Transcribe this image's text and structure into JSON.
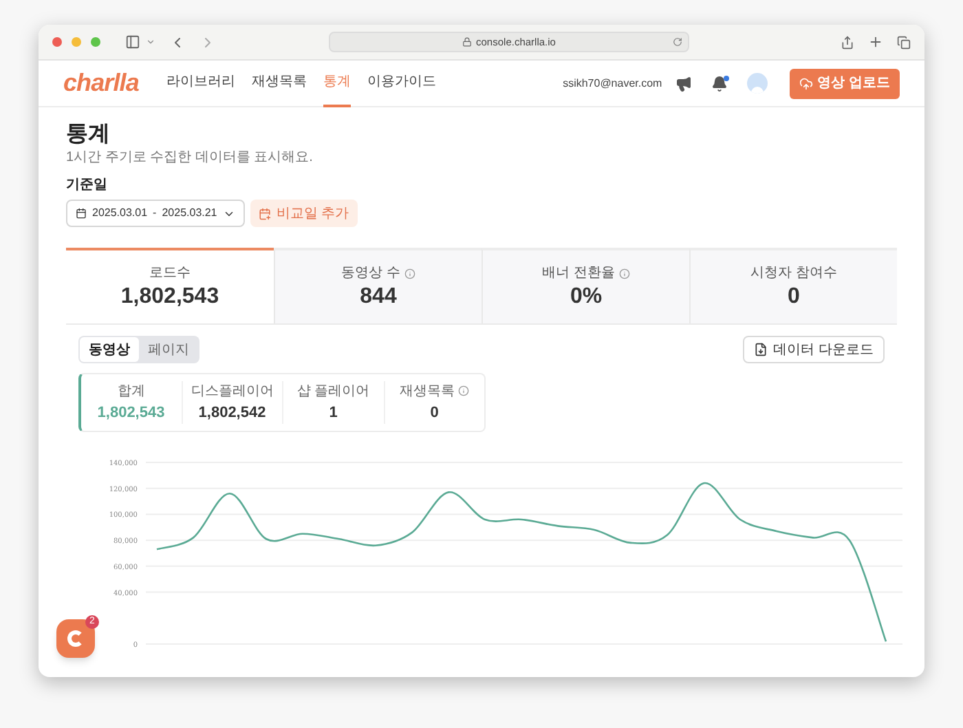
{
  "browser": {
    "url": "console.charlla.io"
  },
  "nav": {
    "logo": "charlla",
    "items": [
      {
        "label": "라이브러리",
        "selected": false
      },
      {
        "label": "재생목록",
        "selected": false
      },
      {
        "label": "통계",
        "selected": true
      },
      {
        "label": "이용가이드",
        "selected": false
      }
    ],
    "email": "ssikh70@naver.com",
    "notification_unread": true,
    "upload_button": "영상 업로드"
  },
  "page": {
    "title": "통계",
    "subtitle": "1시간 주기로 수집한 데이터를 표시해요.",
    "date_label": "기준일",
    "date_start": "2025.03.01",
    "date_separator": "-",
    "date_end": "2025.03.21",
    "compare_button": "비교일 추가"
  },
  "metrics": [
    {
      "label": "로드수",
      "value": "1,802,543",
      "info": false,
      "selected": true
    },
    {
      "label": "동영상 수",
      "value": "844",
      "info": true,
      "selected": false
    },
    {
      "label": "배너 전환율",
      "value": "0%",
      "info": true,
      "selected": false
    },
    {
      "label": "시청자 참여수",
      "value": "0",
      "info": false,
      "selected": false
    }
  ],
  "view_tabs": [
    {
      "label": "동영상",
      "selected": true
    },
    {
      "label": "페이지",
      "selected": false
    }
  ],
  "download_button": "데이터 다운로드",
  "summary": [
    {
      "label": "합계",
      "value": "1,802,543",
      "info": false,
      "highlight": true
    },
    {
      "label": "디스플레이어",
      "value": "1,802,542",
      "info": false,
      "highlight": false
    },
    {
      "label": "샵 플레이어",
      "value": "1",
      "info": false,
      "highlight": false
    },
    {
      "label": "재생목록",
      "value": "0",
      "info": true,
      "highlight": false
    }
  ],
  "chart_data": {
    "type": "line",
    "grid": true,
    "ylim": [
      0,
      140000
    ],
    "yticks": [
      {
        "value": 0,
        "label": "0"
      },
      {
        "value": 40000,
        "label": "40,000"
      },
      {
        "value": 60000,
        "label": "60,000"
      },
      {
        "value": 80000,
        "label": "80,000"
      },
      {
        "value": 100000,
        "label": "100,000"
      },
      {
        "value": 120000,
        "label": "120,000"
      },
      {
        "value": 140000,
        "label": "140,000"
      }
    ],
    "series": [
      {
        "color": "#5aaa94",
        "values": [
          73000,
          82000,
          116000,
          81000,
          85000,
          81000,
          76000,
          86000,
          117000,
          96000,
          96000,
          91000,
          88000,
          78000,
          84000,
          124000,
          96000,
          87000,
          82000,
          80000,
          2000
        ]
      }
    ]
  },
  "chat_button": {
    "badge": "2"
  }
}
